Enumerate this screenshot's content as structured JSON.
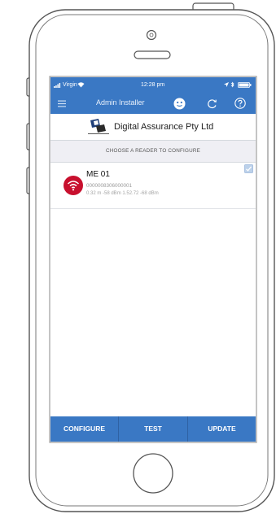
{
  "status_bar": {
    "carrier": "Virgin",
    "time": "12:28 pm"
  },
  "app_bar": {
    "title": "Admin Installer",
    "icons": [
      "menu-icon",
      "user-status-icon",
      "refresh-icon",
      "help-icon"
    ]
  },
  "brand": {
    "company_name": "Digital Assurance Pty Ltd"
  },
  "section": {
    "header": "CHOOSE A READER TO CONFIGURE"
  },
  "readers": [
    {
      "name": "ME 01",
      "id": "0000008306000001",
      "meta": "0.32 m  -58 dBm  1.52.72  -68 dBm",
      "selected": true,
      "icon": "wifi-icon"
    }
  ],
  "bottom_bar": {
    "configure": "CONFIGURE",
    "test": "TEST",
    "update": "UPDATE"
  },
  "colors": {
    "accent": "#3a78c4",
    "reader_icon": "#c8102e",
    "section_bg": "#efeff4"
  }
}
